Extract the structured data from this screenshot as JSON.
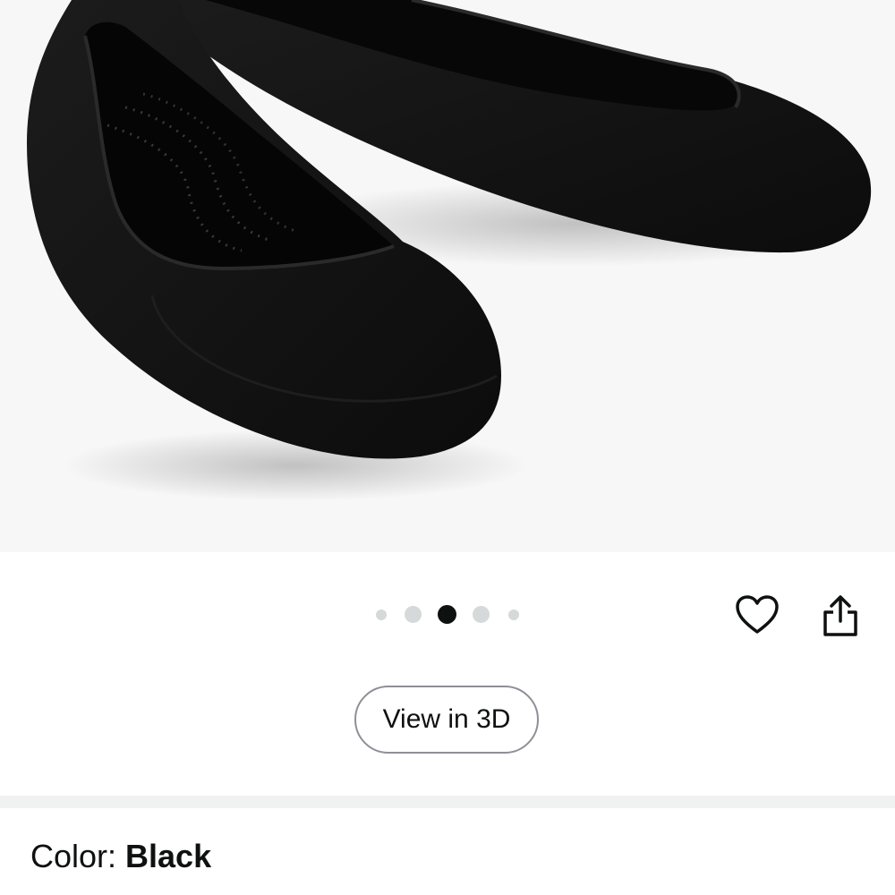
{
  "gallery": {
    "image_alt": "Black ballet flat shoes",
    "dots_total": 5,
    "active_dot_index": 2
  },
  "actions": {
    "wishlist_icon": "heart-icon",
    "share_icon": "share-icon"
  },
  "view_3d": {
    "label": "View in 3D"
  },
  "color": {
    "label": "Color: ",
    "value": "Black"
  },
  "colors": {
    "background": "#f7f7f7",
    "shoe": "#141414",
    "dot_active": "#0f1111",
    "dot_inactive": "#d5d9d9",
    "text": "#0f1111"
  }
}
